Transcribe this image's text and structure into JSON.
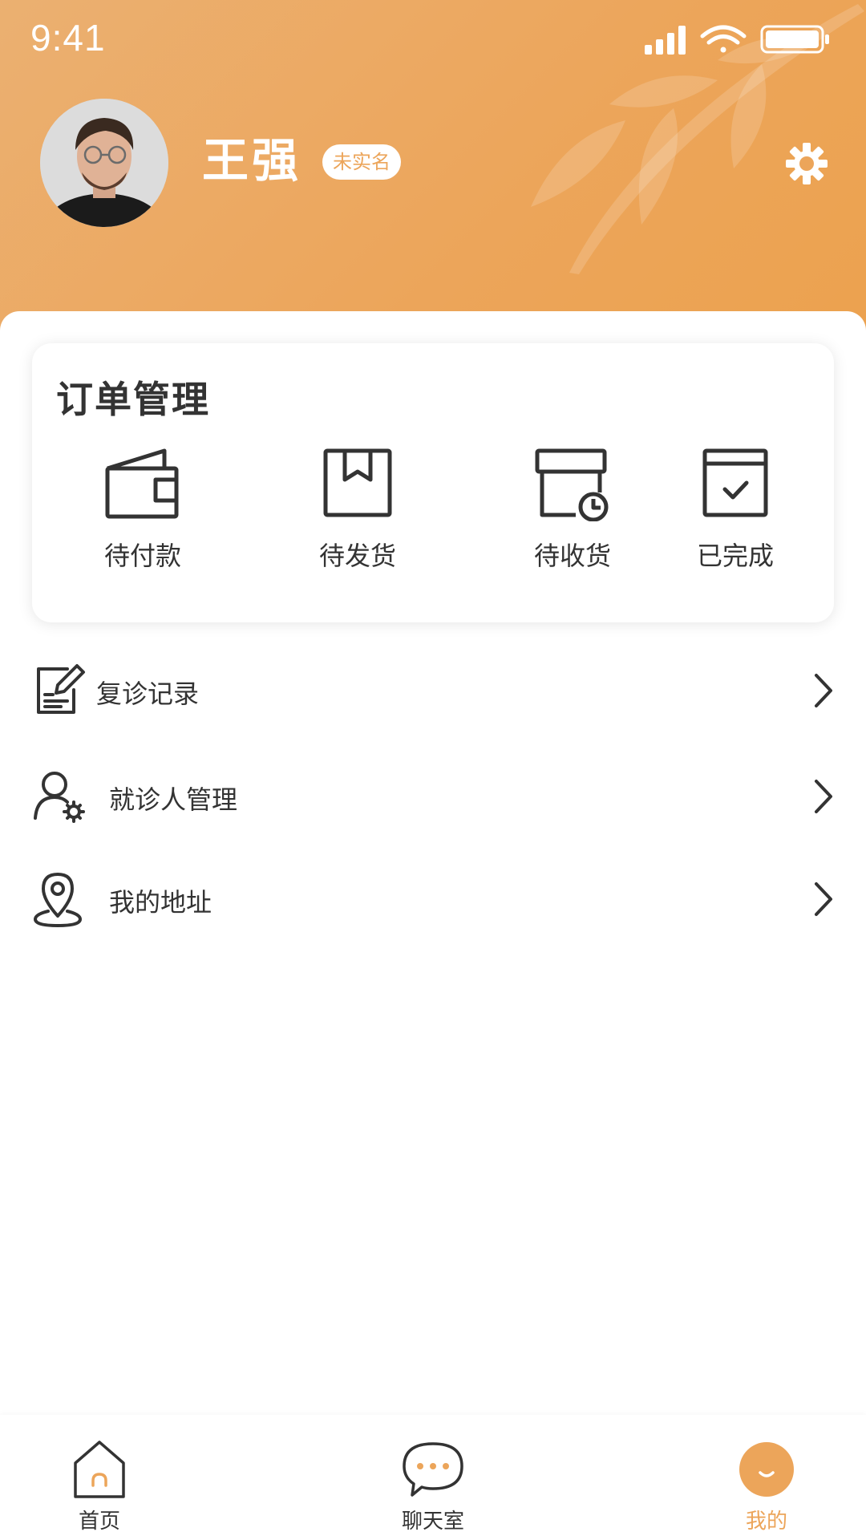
{
  "status_bar": {
    "time": "9:41"
  },
  "profile": {
    "name": "王强",
    "verification_badge": "未实名"
  },
  "order_management": {
    "title": "订单管理",
    "items": [
      {
        "label": "待付款",
        "icon": "wallet-icon"
      },
      {
        "label": "待发货",
        "icon": "package-icon"
      },
      {
        "label": "待收货",
        "icon": "delivery-box-clock-icon"
      },
      {
        "label": "已完成",
        "icon": "calendar-check-icon"
      }
    ]
  },
  "menu": [
    {
      "label": "复诊记录",
      "icon": "edit-record-icon"
    },
    {
      "label": "就诊人管理",
      "icon": "user-settings-icon"
    },
    {
      "label": "我的地址",
      "icon": "location-pin-icon"
    }
  ],
  "tab_bar": {
    "tabs": [
      {
        "label": "首页",
        "icon": "home-icon",
        "active": false
      },
      {
        "label": "聊天室",
        "icon": "chat-bubble-icon",
        "active": false
      },
      {
        "label": "我的",
        "icon": "smile-face-icon",
        "active": true
      }
    ]
  },
  "colors": {
    "accent": "#eca55a",
    "header_gradient_start": "#ebb071",
    "header_gradient_end": "#eca24f",
    "text_primary": "#333333"
  }
}
